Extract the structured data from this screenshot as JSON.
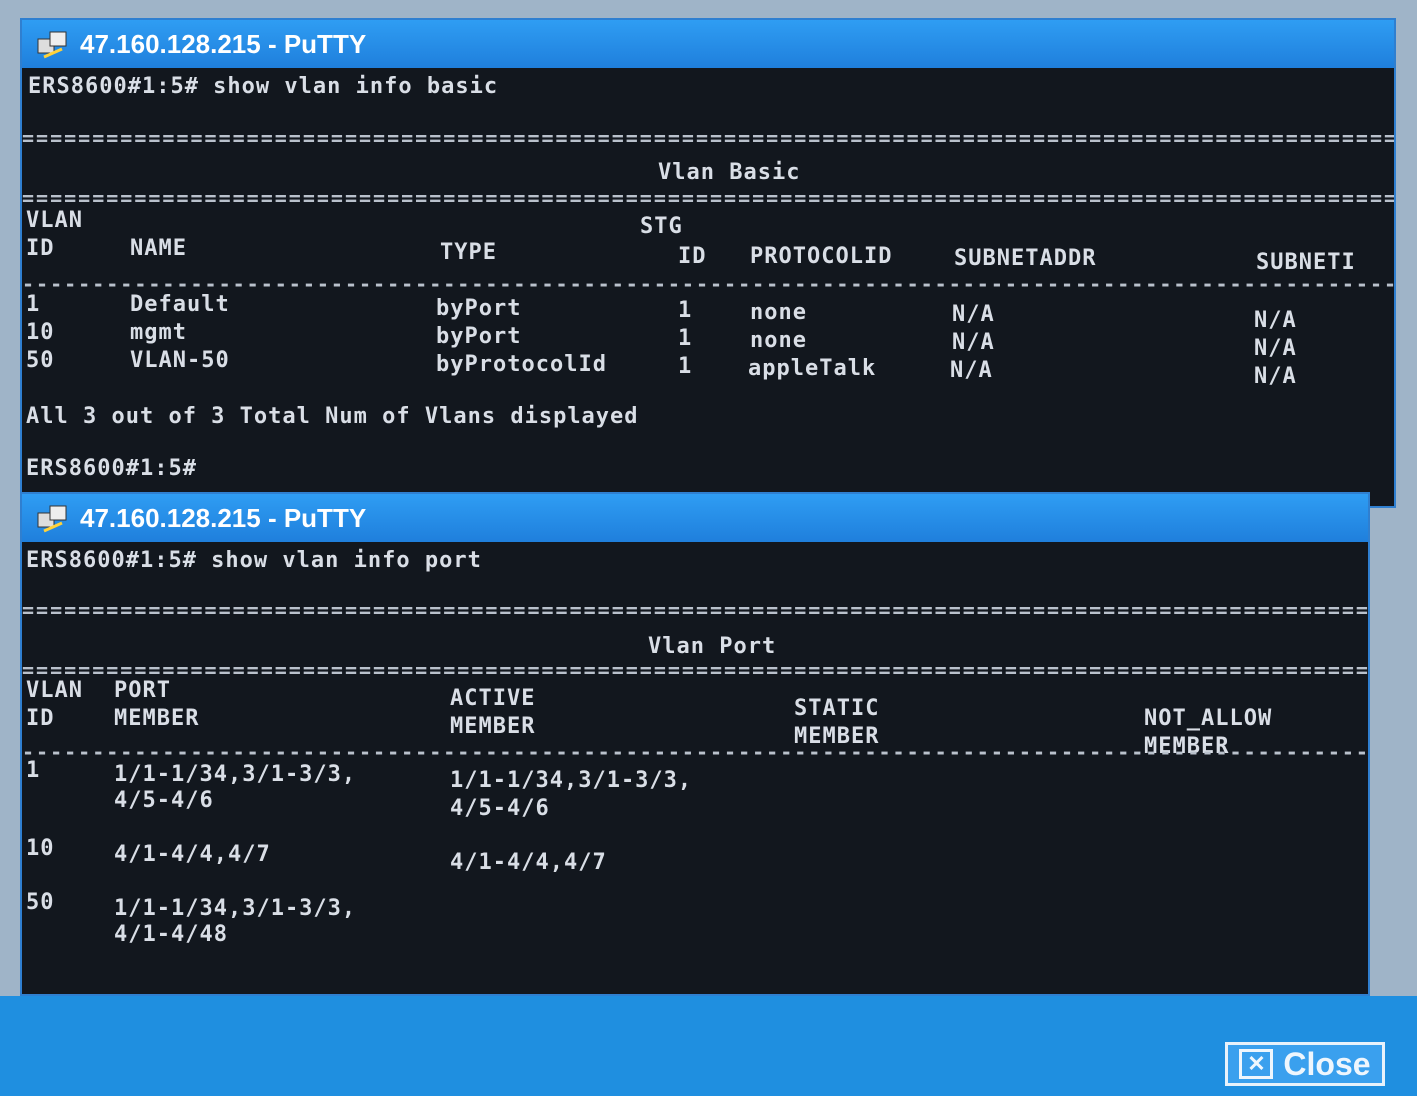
{
  "window_basic": {
    "title": "47.160.128.215 - PuTTY",
    "prompt_cmd": "ERS8600#1:5# show vlan info basic",
    "section_title": "Vlan Basic",
    "headers": {
      "vlan": "VLAN",
      "id": "ID",
      "name": "NAME",
      "type": "TYPE",
      "stg": "STG",
      "stg_id": "ID",
      "protocolid": "PROTOCOLID",
      "subnetaddr": "SUBNETADDR",
      "subnetmask": "SUBNETI"
    },
    "rows": [
      {
        "id": "1",
        "name": "Default",
        "type": "byPort",
        "stg": "1",
        "protocol": "none",
        "subnet": "N/A",
        "mask": "N/A"
      },
      {
        "id": "10",
        "name": "mgmt",
        "type": "byPort",
        "stg": "1",
        "protocol": "none",
        "subnet": "N/A",
        "mask": "N/A"
      },
      {
        "id": "50",
        "name": "VLAN-50",
        "type": "byProtocolId",
        "stg": "1",
        "protocol": "appleTalk",
        "subnet": "N/A",
        "mask": "N/A"
      }
    ],
    "summary": "All 3 out of 3 Total Num of Vlans displayed",
    "prompt_end": "ERS8600#1:5#"
  },
  "window_port": {
    "title": "47.160.128.215 - PuTTY",
    "prompt_cmd": "ERS8600#1:5# show vlan info port",
    "section_title": "Vlan Port",
    "headers": {
      "vlan": "VLAN",
      "id": "ID",
      "port": "PORT",
      "port_member": "MEMBER",
      "active": "ACTIVE",
      "active_member": "MEMBER",
      "static": "STATIC",
      "static_member": "MEMBER",
      "notallow": "NOT_ALLOW",
      "notallow_member": "MEMBER"
    },
    "rows": [
      {
        "id": "1",
        "port_l1": "1/1-1/34,3/1-3/3,",
        "port_l2": "4/5-4/6",
        "active_l1": "1/1-1/34,3/1-3/3,",
        "active_l2": "4/5-4/6"
      },
      {
        "id": "10",
        "port_l1": "4/1-4/4,4/7",
        "port_l2": "",
        "active_l1": "4/1-4/4,4/7",
        "active_l2": ""
      },
      {
        "id": "50",
        "port_l1": "1/1-1/34,3/1-3/3,",
        "port_l2": "4/1-4/48",
        "active_l1": "",
        "active_l2": ""
      }
    ]
  },
  "close_button": {
    "label": "Close"
  },
  "colors": {
    "titlebar": "#1f7fdc",
    "terminal_bg": "#12171e",
    "terminal_text": "#d9dee6"
  }
}
